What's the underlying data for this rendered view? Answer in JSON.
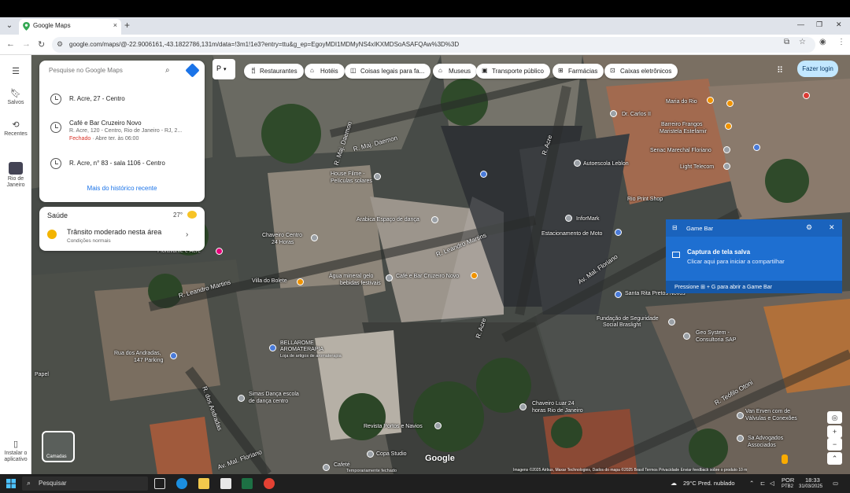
{
  "browser": {
    "tab_title": "Google Maps",
    "tab_close": "×",
    "new_tab": "+",
    "url": "google.com/maps/@-22.9006161,-43.1822786,131m/data=!3m1!1e3?entry=ttu&g_ep=EgoyMDI1MDMyNS4xIKXMDSoASAFQAw%3D%3D"
  },
  "left_rail": {
    "saved": "Salvos",
    "recent": "Recentes",
    "rio": "Rio de Janeiro",
    "install": "Instalar o aplicativo"
  },
  "search": {
    "placeholder": "Pesquise no Google Maps",
    "history": [
      {
        "title": "R. Acre, 27 - Centro"
      },
      {
        "title": "Café e Bar Cruzeiro Novo",
        "sub": "R. Acre, 120 - Centro, Rio de Janeiro - RJ, 2...",
        "status": "Fechado",
        "hours": " · Abre ter. às 06:00"
      },
      {
        "title": "R. Acre, n° 83 - sala 1106 - Centro"
      }
    ],
    "more_history": "Mais do histórico recente"
  },
  "health_card": {
    "title": "Saúde",
    "temp": "27°",
    "traffic": "Trânsito moderado nesta área",
    "traffic_sub": "Condições normais"
  },
  "chips": {
    "p": "P",
    "restaurants": "Restaurantes",
    "hotels": "Hotéis",
    "things": "Coisas legais para fa...",
    "museums": "Museus",
    "transit": "Transporte público",
    "pharmacies": "Farmácias",
    "atms": "Caixas eletrônicos"
  },
  "login": "Fazer login",
  "map_labels": {
    "s1": "R. Maj. Daemon",
    "s2": "R. Maj. Daemon",
    "s3": "R. Acre",
    "s4": "R. Leandro Martins",
    "s5": "R. Leandro Martins",
    "s6": "Av. Mal. Floriano",
    "s7": "R. dos Andradas",
    "s8": "Av. Mal. Floriano",
    "s9": "R. Teófilo Otoni",
    "s10": "R. Acre",
    "p1": "House Filme -",
    "p1b": "Películas solares",
    "p2": "Arabica Espaço de dança",
    "p3": "Chaveiro Centro",
    "p3b": "24 Horas",
    "p4": "Água mineral gelo",
    "p4b": "bebidas festivais",
    "p5": "Café e Bar Cruzeiro Novo",
    "p6": "Villa do Bolete",
    "p7": "Floravante e Acre",
    "p8": "BELLAROME",
    "p8b": "AROMATERAPIA",
    "p8c": "Loja de artigos de aromaterapia",
    "p9": "Rua dos Andradas,",
    "p9b": "147 Parking",
    "p10": "Simas Dança escola",
    "p10b": "de dança centro",
    "p11": "Revista Portos e Navios",
    "p12": "Copa Studio",
    "p13": "Cafeté",
    "p13b": "Temporariamente fechado",
    "p14": "Chaveiro Luar 24",
    "p14b": "horas Rio de Janeiro",
    "p15": "Autoescola Leblon",
    "p16": "InforMark",
    "p17": "Estacionamento de Moto",
    "p18": "Santa Rita Pretos Novos",
    "p19": "Fundação de Seguridade",
    "p19b": "Social Braslight",
    "p20": "Geo System -",
    "p20b": "Consultoria SAP",
    "p21": "Light Telecom",
    "p22": "Senac Marechal Floriano",
    "p23": "Maria do Rio",
    "p24": "Dr. Carlos II",
    "p25": "Barreiro Frangos",
    "p25b": "Maristela Estefamir",
    "p26": "Rio Print Shop",
    "p27": "Van Erven com de",
    "p27b": "Válvulas e Conexões",
    "p28": "Sa Advogados",
    "p28b": "Associados",
    "p29": "Papel"
  },
  "gamebar": {
    "title": "Game Bar",
    "message": "Captura de tela salva",
    "sub": "Clicar aqui para iniciar a compartilhar",
    "hint": "Pressione ⊞ + G para abrir a Game Bar"
  },
  "map_controls": {
    "layers": "Camadas",
    "google": "Google",
    "attribution": "Imagens ©2025 Airbus, Maxar Technologies, Dados do mapa ©2025   Brasil   Termos   Privacidade   Enviar feedback sobre o produto   10 m"
  },
  "taskbar": {
    "search": "Pesquisar",
    "weather": "29°C  Pred. nublado",
    "lang": "POR",
    "lang2": "PTB2",
    "time": "18:33",
    "date": "31/03/2025"
  },
  "colors": {
    "accent": "#1a73e8",
    "gamebar": "#1e6fd1",
    "login_bg": "#c2e7ff",
    "closed": "#d93025"
  }
}
